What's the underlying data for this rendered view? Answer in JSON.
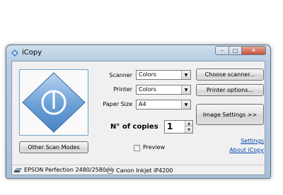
{
  "window": {
    "title": "iCopy",
    "controls": {
      "minimize": "–",
      "maximize": "□",
      "close": "✕"
    }
  },
  "scan": {
    "icon": "power-icon"
  },
  "buttons": {
    "other_scan_modes": "Other Scan Modes",
    "choose_scanner": "Choose scanner...",
    "printer_options": "Printer options...",
    "image_settings": "Image Settings >>"
  },
  "form": {
    "scanner_label": "Scanner",
    "scanner_value": "Colors",
    "printer_label": "Printer",
    "printer_value": "Colors",
    "paper_size_label": "Paper Size",
    "paper_size_value": "A4",
    "copies_label": "N° of copies",
    "copies_value": "1",
    "preview_label": "Preview",
    "preview_checked": false
  },
  "links": {
    "settings": "Settings",
    "about": "About iCopy"
  },
  "status": {
    "scanner": "EPSON Perfection 2480/2580",
    "printer": "Canon Inkjet iP4200"
  },
  "colors": {
    "accent": "#5b8fc9",
    "link": "#0645ad"
  }
}
